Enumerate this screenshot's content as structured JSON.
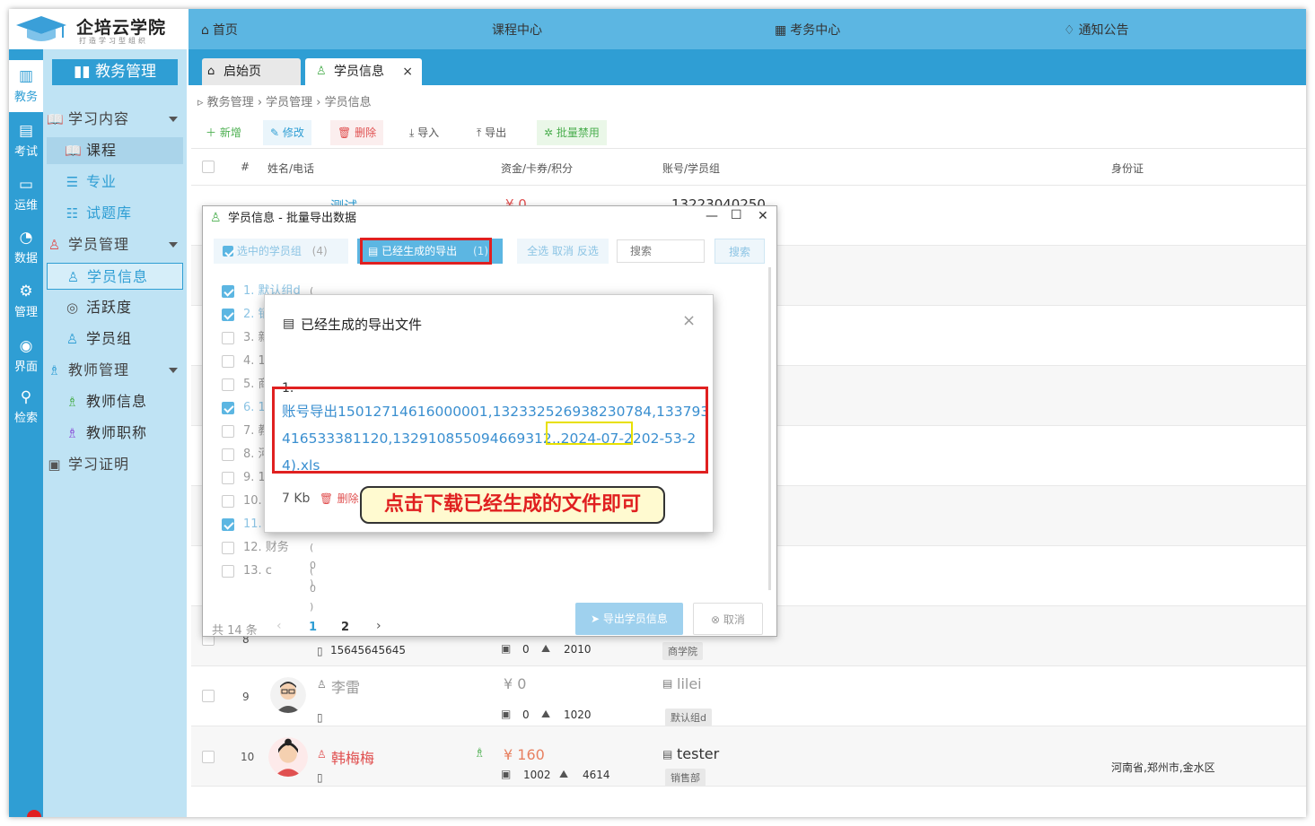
{
  "brand": {
    "name": "企培云学院",
    "slogan": "打造学习型组织"
  },
  "rail": [
    {
      "label": "教务",
      "icon": "bar-chart-icon"
    },
    {
      "label": "考试",
      "icon": "exam-icon"
    },
    {
      "label": "运维",
      "icon": "monitor-icon"
    },
    {
      "label": "数据",
      "icon": "pie-chart-icon"
    },
    {
      "label": "管理",
      "icon": "gear-icon"
    },
    {
      "label": "界面",
      "icon": "ui-icon"
    },
    {
      "label": "检索",
      "icon": "search-icon"
    }
  ],
  "menu": {
    "head": "教务管理",
    "items": [
      {
        "label": "学习内容"
      },
      {
        "label": "课程"
      },
      {
        "label": "专业"
      },
      {
        "label": "试题库"
      },
      {
        "label": "学员管理"
      },
      {
        "label": "学员信息"
      },
      {
        "label": "活跃度"
      },
      {
        "label": "学员组"
      },
      {
        "label": "教师管理"
      },
      {
        "label": "教师信息"
      },
      {
        "label": "教师职称"
      },
      {
        "label": "学习证明"
      }
    ]
  },
  "topnav": {
    "home": "首页",
    "courses": "课程中心",
    "exams": "考务中心",
    "notice": "通知公告"
  },
  "tabs": {
    "start": "启始页",
    "students": "学员信息",
    "close": "×"
  },
  "breadcrumb": [
    "教务管理",
    "学员管理",
    "学员信息"
  ],
  "toolbar": {
    "add": "新增",
    "edit": "修改",
    "delete": "删除",
    "import": "导入",
    "export": "导出",
    "disable": "批量禁用"
  },
  "table": {
    "headers": {
      "num": "#",
      "name": "姓名/电话",
      "money": "资金/卡券/积分",
      "account": "账号/学员组",
      "id": "身份证"
    },
    "top_row": {
      "name": "测试",
      "money": "¥ 0",
      "account": "13223040250"
    },
    "rows": [
      {
        "num": "8",
        "phone": "15645645645",
        "card": "0",
        "points": "2010",
        "group": "商学院"
      },
      {
        "num": "9",
        "name": "李雷",
        "money": "¥ 0",
        "card": "0",
        "points": "1020",
        "account": "lilei",
        "group": "默认组d"
      },
      {
        "num": "10",
        "name": "韩梅梅",
        "money": "¥ 160",
        "card": "1002",
        "points": "4614",
        "account": "tester",
        "group": "销售部",
        "id": "河南省,郑州市,金水区"
      }
    ]
  },
  "export_dialog": {
    "title": "学员信息 - 批量导出数据",
    "tab_selected": "选中的学员组",
    "tab_selected_count": "(4)",
    "tab_generated": "已经生成的导出",
    "tab_generated_count": "(1)",
    "select_all": "全选",
    "cancel_select": "取消",
    "invert": "反选",
    "search_placeholder": "搜索",
    "search_button": "搜索",
    "groups": [
      {
        "label": "1. 默认组d",
        "count": "( 1 )",
        "checked": true
      },
      {
        "label": "2. 销",
        "count": "",
        "checked": true
      },
      {
        "label": "3. 新",
        "count": "",
        "checked": false
      },
      {
        "label": "4. 1",
        "count": "",
        "checked": false
      },
      {
        "label": "5. 商",
        "count": "",
        "checked": false
      },
      {
        "label": "6. 1",
        "count": "",
        "checked": true
      },
      {
        "label": "7. 教",
        "count": "",
        "checked": false
      },
      {
        "label": "8. 河",
        "count": "",
        "checked": false
      },
      {
        "label": "9. 1",
        "count": "",
        "checked": false
      },
      {
        "label": "10.",
        "count": "",
        "checked": false
      },
      {
        "label": "11.",
        "count": "",
        "checked": true
      },
      {
        "label": "12. 财务",
        "count": "( 0 )",
        "checked": false
      },
      {
        "label": "13. c",
        "count": "( 0 )",
        "checked": false
      }
    ],
    "total": "共 14 条",
    "pages": [
      "1",
      "2"
    ],
    "export_button": "导出学员信息",
    "cancel_button": "取消"
  },
  "files_dialog": {
    "title": "已经生成的导出文件",
    "index": "1.",
    "file_part1": "账号导出15012714616000001,132332526938230784,133793",
    "file_part2a": "416533381120,132910855094669312,.",
    "file_date": "2024-07-22",
    "file_part2b": "02-53-2",
    "file_part3": "4).xls",
    "size": "7 Kb",
    "delete": "删除"
  },
  "callout": "点击下载已经生成的文件即可"
}
